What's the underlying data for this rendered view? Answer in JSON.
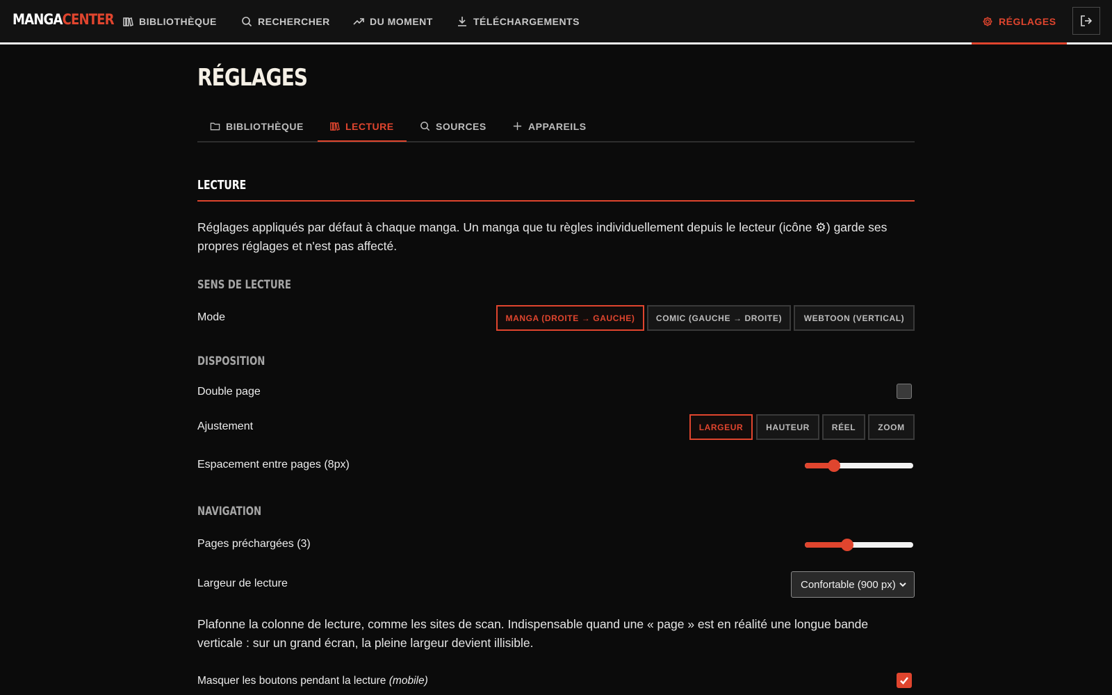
{
  "app": {
    "logo_part1": "MANGA",
    "logo_part2": "CENTER",
    "accent_color": "#e0452e"
  },
  "topnav": {
    "items": [
      {
        "label": "BIBLIOTHÈQUE",
        "icon": "books-icon"
      },
      {
        "label": "RECHERCHER",
        "icon": "search-icon"
      },
      {
        "label": "DU MOMENT",
        "icon": "trending-icon"
      },
      {
        "label": "TÉLÉCHARGEMENTS",
        "icon": "download-icon"
      }
    ],
    "settings_label": "RÉGLAGES",
    "settings_icon": "gear-icon",
    "logout_icon": "logout-icon"
  },
  "page": {
    "title": "RÉGLAGES"
  },
  "tabs": [
    {
      "label": "BIBLIOTHÈQUE",
      "icon": "folder-icon",
      "active": false
    },
    {
      "label": "LECTURE",
      "icon": "books-icon",
      "active": true
    },
    {
      "label": "SOURCES",
      "icon": "search-icon",
      "active": false
    },
    {
      "label": "APPAREILS",
      "icon": "plus-icon",
      "active": false
    }
  ],
  "section": {
    "title": "LECTURE",
    "description": "Réglages appliqués par défaut à chaque manga. Un manga que tu règles individuellement depuis le lecteur (icône ⚙) garde ses propres réglages et n'est pas affecté."
  },
  "reading_direction": {
    "heading": "SENS DE LECTURE",
    "label": "Mode",
    "options": [
      "MANGA (DROITE → GAUCHE)",
      "COMIC (GAUCHE → DROITE)",
      "WEBTOON (VERTICAL)"
    ],
    "selected": "MANGA (DROITE → GAUCHE)"
  },
  "layout": {
    "heading": "DISPOSITION",
    "double_page_label": "Double page",
    "double_page_checked": false,
    "fit_label": "Ajustement",
    "fit_options": [
      "LARGEUR",
      "HAUTEUR",
      "RÉEL",
      "ZOOM"
    ],
    "fit_selected": "LARGEUR",
    "spacing_label": "Espacement entre pages (8px)",
    "spacing_fraction": 0.27
  },
  "navigation": {
    "heading": "NAVIGATION",
    "preload_label": "Pages préchargées (3)",
    "preload_fraction": 0.39,
    "width_label": "Largeur de lecture",
    "width_value": "Confortable (900 px)",
    "width_description": "Plafonne la colonne de lecture, comme les sites de scan. Indispensable quand une « page » est en réalité une longue bande verticale : sur un grand écran, la pleine largeur devient illisible.",
    "hide_buttons_label": "Masquer les boutons pendant la lecture",
    "hide_buttons_suffix": "(mobile)",
    "hide_buttons_checked": true
  }
}
